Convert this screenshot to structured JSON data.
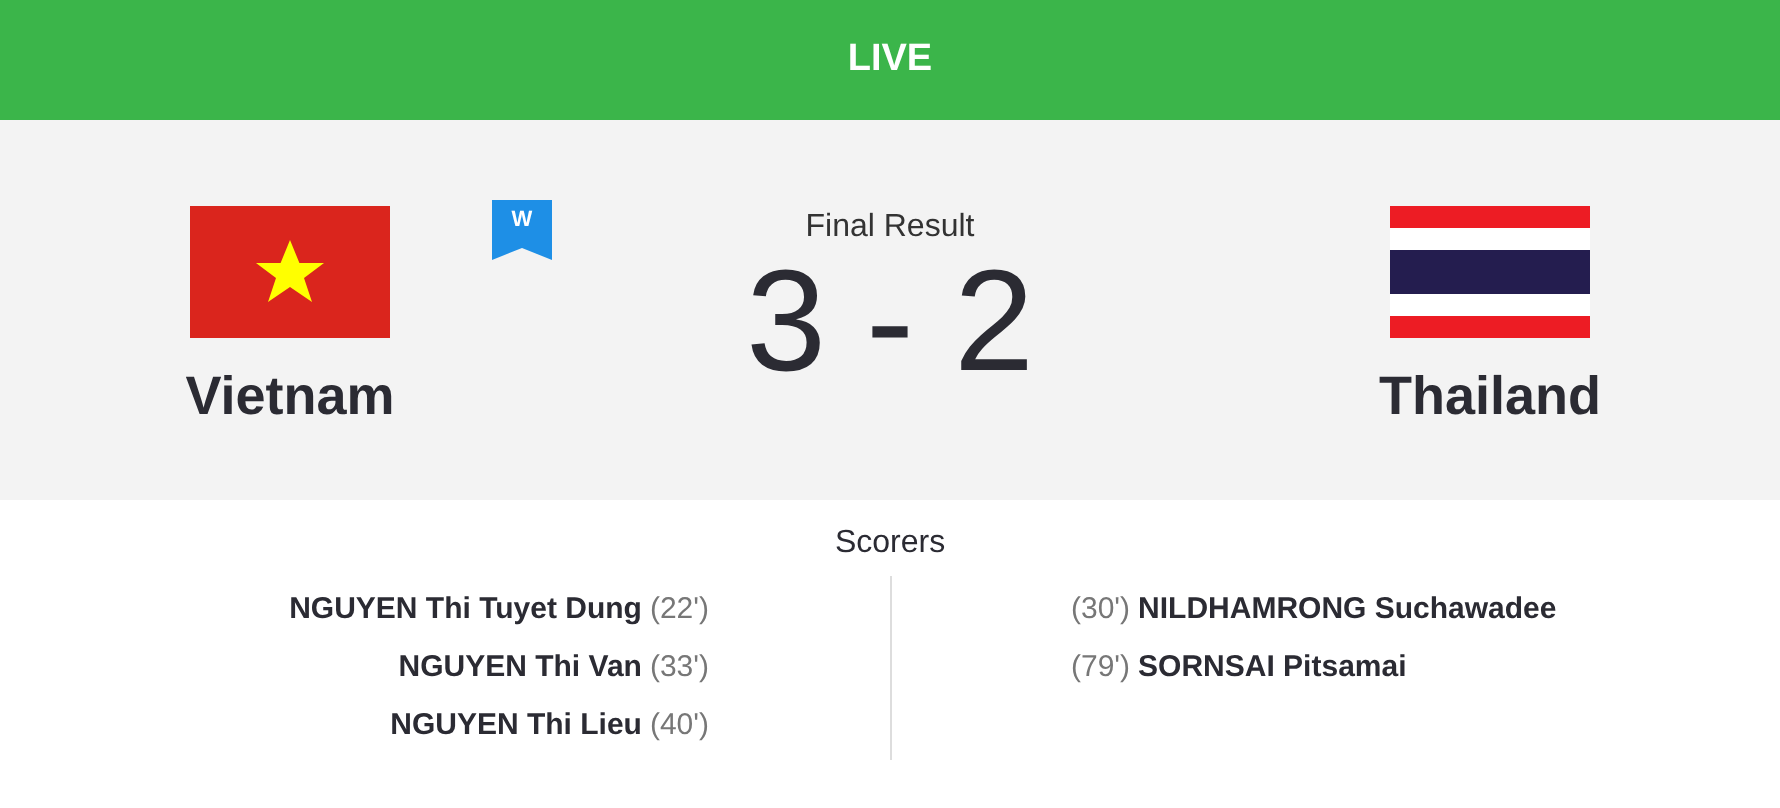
{
  "status_bar": {
    "label": "LIVE"
  },
  "match": {
    "result_label": "Final Result",
    "score": "3 - 2",
    "badge": "W",
    "home": {
      "name": "Vietnam",
      "kind": "vietnam"
    },
    "away": {
      "name": "Thailand",
      "kind": "thailand"
    }
  },
  "scorers": {
    "title": "Scorers",
    "home": [
      {
        "name": "NGUYEN Thi Tuyet Dung",
        "minute": "(22')"
      },
      {
        "name": "NGUYEN Thi Van",
        "minute": "(33')"
      },
      {
        "name": "NGUYEN Thi Lieu",
        "minute": "(40')"
      }
    ],
    "away": [
      {
        "name": "NILDHAMRONG Suchawadee",
        "minute": "(30')"
      },
      {
        "name": "SORNSAI Pitsamai",
        "minute": "(79')"
      }
    ]
  }
}
